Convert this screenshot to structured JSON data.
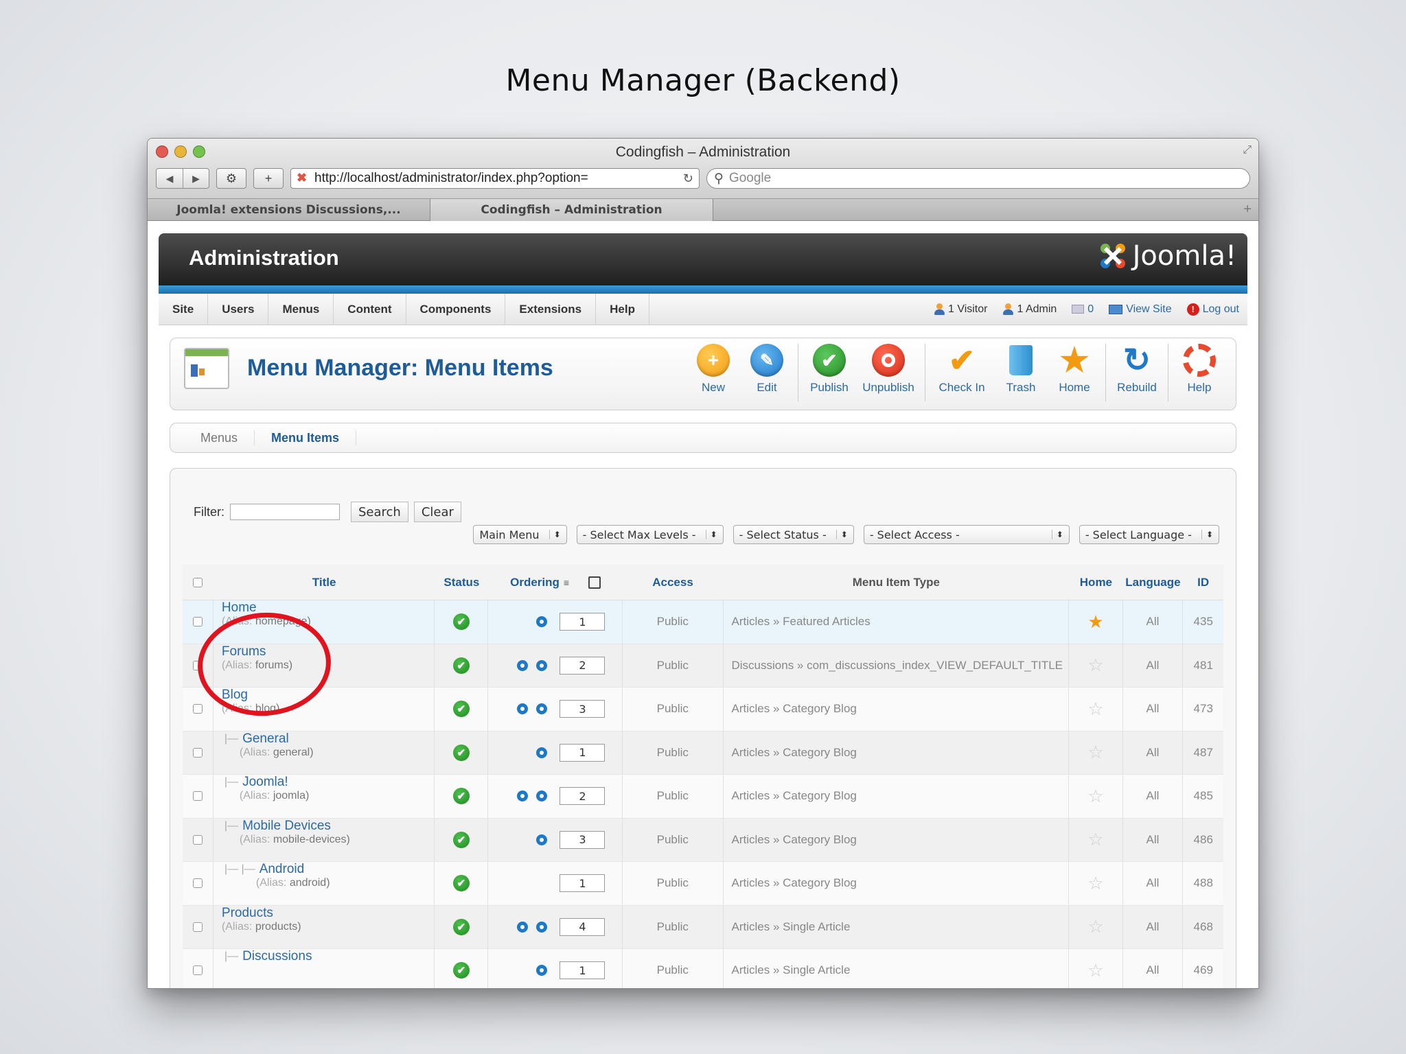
{
  "slide": {
    "title": "Menu Manager (Backend)"
  },
  "browser": {
    "window_title": "Codingfish – Administration",
    "url": "http://localhost/administrator/index.php?option=",
    "search_placeholder": "Google",
    "tabs": [
      {
        "label": "Joomla! extensions Discussions,...",
        "active": false
      },
      {
        "label": "Codingfish – Administration",
        "active": true
      }
    ]
  },
  "admin": {
    "header_title": "Administration",
    "logo_text": "Joomla!",
    "menu": [
      "Site",
      "Users",
      "Menus",
      "Content",
      "Components",
      "Extensions",
      "Help"
    ],
    "status": {
      "visitors": "1 Visitor",
      "admins": "1 Admin",
      "messages": "0",
      "view_site": "View Site",
      "logout": "Log out"
    }
  },
  "toolbar": {
    "page_title": "Menu Manager: Menu Items",
    "buttons": {
      "new": "New",
      "edit": "Edit",
      "publish": "Publish",
      "unpublish": "Unpublish",
      "checkin": "Check In",
      "trash": "Trash",
      "home": "Home",
      "rebuild": "Rebuild",
      "help": "Help"
    }
  },
  "subtabs": {
    "menus": "Menus",
    "items": "Menu Items"
  },
  "filters": {
    "label": "Filter:",
    "search_btn": "Search",
    "clear_btn": "Clear",
    "selects": {
      "menu": "Main Menu",
      "levels": "- Select Max Levels -",
      "status": "- Select Status -",
      "access": "- Select Access -",
      "language": "- Select Language -"
    }
  },
  "table": {
    "headers": {
      "title": "Title",
      "status": "Status",
      "ordering": "Ordering",
      "access": "Access",
      "type": "Menu Item Type",
      "home": "Home",
      "language": "Language",
      "id": "ID"
    },
    "alias_prefix": "(Alias:",
    "rows": [
      {
        "title": "Home",
        "alias": "homepage)",
        "order": "1",
        "access": "Public",
        "type": "Articles » Featured Articles",
        "lang": "All",
        "id": "435"
      },
      {
        "title": "Forums",
        "alias": "forums)",
        "order": "2",
        "access": "Public",
        "type": "Discussions » com_discussions_index_VIEW_DEFAULT_TITLE",
        "lang": "All",
        "id": "481"
      },
      {
        "title": "Blog",
        "alias": "blog)",
        "order": "3",
        "access": "Public",
        "type": "Articles » Category Blog",
        "lang": "All",
        "id": "473"
      },
      {
        "title": "General",
        "alias": "general)",
        "order": "1",
        "access": "Public",
        "type": "Articles » Category Blog",
        "lang": "All",
        "id": "487"
      },
      {
        "title": "Joomla!",
        "alias": "joomla)",
        "order": "2",
        "access": "Public",
        "type": "Articles » Category Blog",
        "lang": "All",
        "id": "485"
      },
      {
        "title": "Mobile Devices",
        "alias": "mobile-devices)",
        "order": "3",
        "access": "Public",
        "type": "Articles » Category Blog",
        "lang": "All",
        "id": "486"
      },
      {
        "title": "Android",
        "alias": "android)",
        "order": "1",
        "access": "Public",
        "type": "Articles » Category Blog",
        "lang": "All",
        "id": "488"
      },
      {
        "title": "Products",
        "alias": "products)",
        "order": "4",
        "access": "Public",
        "type": "Articles » Single Article",
        "lang": "All",
        "id": "468"
      },
      {
        "title": "Discussions",
        "alias": "",
        "order": "1",
        "access": "Public",
        "type": "Articles » Single Article",
        "lang": "All",
        "id": "469"
      }
    ]
  },
  "colors": {
    "accent_blue": "#1e5c99",
    "link_blue": "#2a6aa5",
    "annotation_red": "#e0141e"
  }
}
